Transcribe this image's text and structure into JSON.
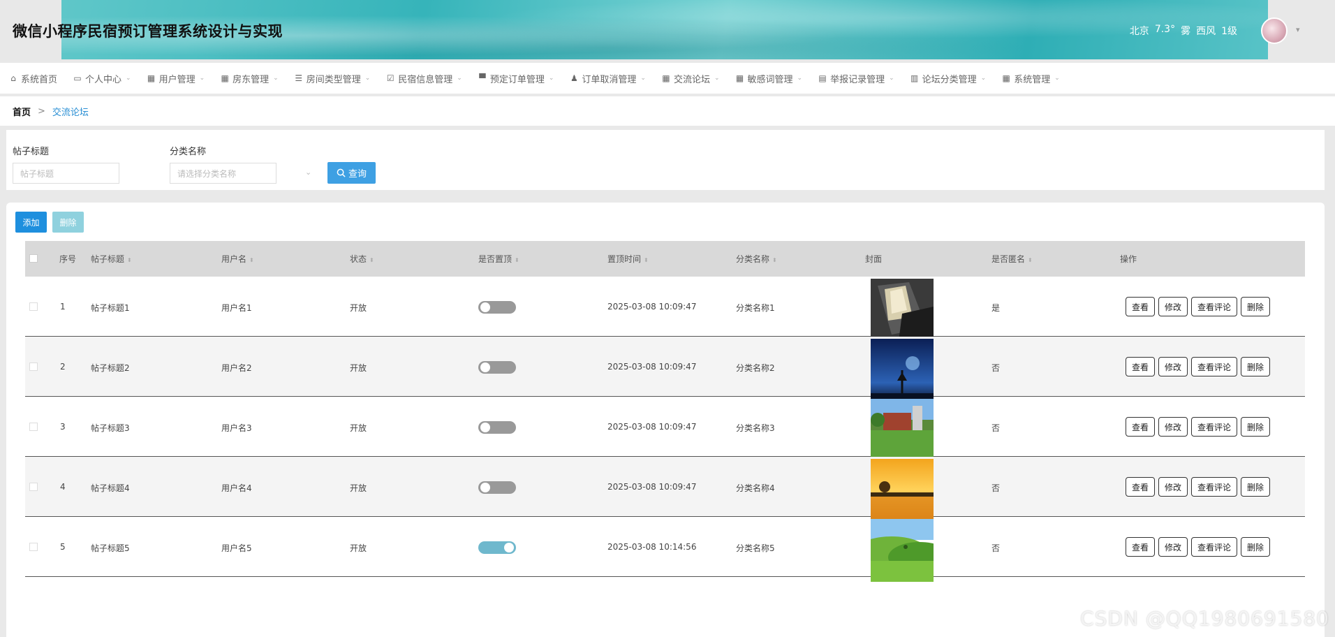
{
  "header": {
    "title": "微信小程序民宿预订管理系统设计与实现",
    "weather": {
      "city": "北京",
      "temp": "7.3°",
      "condition": "雾",
      "wind": "西风",
      "level": "1级"
    }
  },
  "nav": {
    "items": [
      {
        "label": "系统首页",
        "icon": "home-icon",
        "glyph": "⌂",
        "caret": false
      },
      {
        "label": "个人中心",
        "icon": "card-icon",
        "glyph": "▭",
        "caret": true
      },
      {
        "label": "用户管理",
        "icon": "grid-icon",
        "glyph": "▦",
        "caret": true
      },
      {
        "label": "房东管理",
        "icon": "grid-icon",
        "glyph": "▦",
        "caret": true
      },
      {
        "label": "房间类型管理",
        "icon": "list-icon",
        "glyph": "☰",
        "caret": true
      },
      {
        "label": "民宿信息管理",
        "icon": "checkbox-icon",
        "glyph": "☑",
        "caret": true
      },
      {
        "label": "预定订单管理",
        "icon": "monitor-icon",
        "glyph": "▀",
        "caret": true
      },
      {
        "label": "订单取消管理",
        "icon": "user-icon",
        "glyph": "♟",
        "caret": true
      },
      {
        "label": "交流论坛",
        "icon": "grid-icon",
        "glyph": "▦",
        "caret": true
      },
      {
        "label": "敏感词管理",
        "icon": "grid-icon",
        "glyph": "▦",
        "caret": true
      },
      {
        "label": "举报记录管理",
        "icon": "clipboard-icon",
        "glyph": "▤",
        "caret": true
      },
      {
        "label": "论坛分类管理",
        "icon": "bar-chart-icon",
        "glyph": "▥",
        "caret": true
      },
      {
        "label": "系统管理",
        "icon": "grid-icon",
        "glyph": "▦",
        "caret": true
      }
    ]
  },
  "breadcrumb": {
    "home": "首页",
    "separator": ">",
    "current": "交流论坛"
  },
  "search": {
    "title_label": "帖子标题",
    "title_placeholder": "帖子标题",
    "category_label": "分类名称",
    "category_placeholder": "请选择分类名称",
    "query_button": "查询"
  },
  "toolbar": {
    "add": "添加",
    "delete": "删除"
  },
  "table": {
    "headers": [
      "序号",
      "帖子标题",
      "用户名",
      "状态",
      "是否置顶",
      "置顶时间",
      "分类名称",
      "封面",
      "是否匿名",
      "操作"
    ],
    "actions": [
      "查看",
      "修改",
      "查看评论",
      "删除"
    ],
    "rows": [
      {
        "no": "1",
        "title": "帖子标题1",
        "user": "用户名1",
        "status": "开放",
        "pinned": false,
        "pin_time": "2025-03-08 10:09:47",
        "category": "分类名称1",
        "cover": "book",
        "anonymous": "是"
      },
      {
        "no": "2",
        "title": "帖子标题2",
        "user": "用户名2",
        "status": "开放",
        "pinned": false,
        "pin_time": "2025-03-08 10:09:47",
        "category": "分类名称2",
        "cover": "night-sky",
        "anonymous": "否"
      },
      {
        "no": "3",
        "title": "帖子标题3",
        "user": "用户名3",
        "status": "开放",
        "pinned": false,
        "pin_time": "2025-03-08 10:09:47",
        "category": "分类名称3",
        "cover": "campus",
        "anonymous": "否"
      },
      {
        "no": "4",
        "title": "帖子标题4",
        "user": "用户名4",
        "status": "开放",
        "pinned": false,
        "pin_time": "2025-03-08 10:09:47",
        "category": "分类名称4",
        "cover": "sunset",
        "anonymous": "否"
      },
      {
        "no": "5",
        "title": "帖子标题5",
        "user": "用户名5",
        "status": "开放",
        "pinned": true,
        "pin_time": "2025-03-08 10:14:56",
        "category": "分类名称5",
        "cover": "green-hills",
        "anonymous": "否"
      }
    ]
  },
  "watermark": "CSDN @QQ1980691580"
}
